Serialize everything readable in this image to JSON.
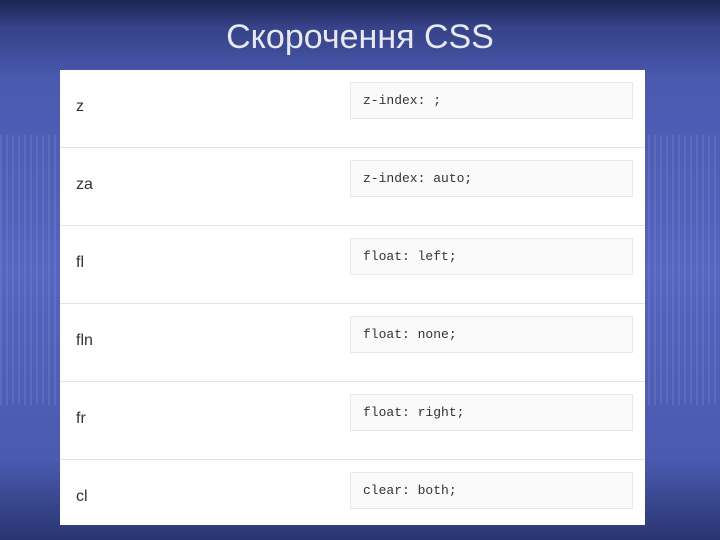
{
  "title": "Скорочення CSS",
  "rows": [
    {
      "abbrev": "z",
      "expansion": "z-index: ;"
    },
    {
      "abbrev": "za",
      "expansion": "z-index: auto;"
    },
    {
      "abbrev": "fl",
      "expansion": "float: left;"
    },
    {
      "abbrev": "fln",
      "expansion": "float: none;"
    },
    {
      "abbrev": "fr",
      "expansion": "float: right;"
    },
    {
      "abbrev": "cl",
      "expansion": "clear: both;"
    }
  ]
}
